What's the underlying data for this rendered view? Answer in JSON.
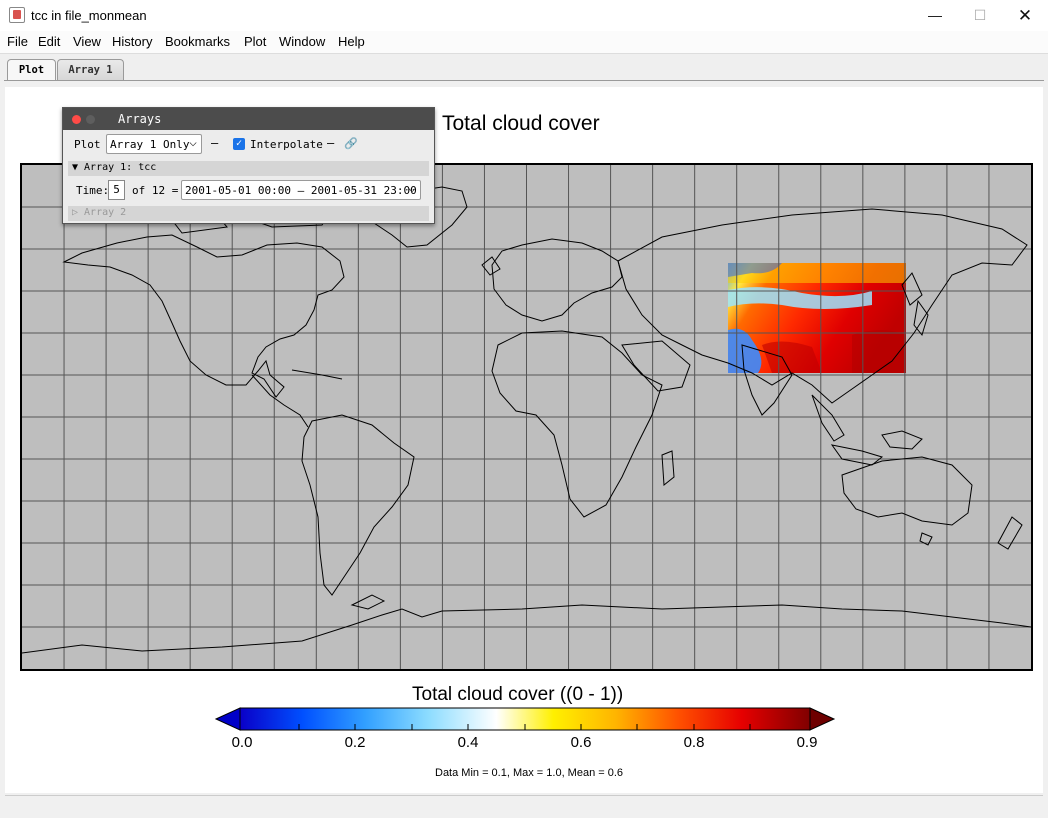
{
  "window": {
    "title": "tcc in file_monmean",
    "minimize": "—",
    "maximize": "☐",
    "close": "✕"
  },
  "menu": [
    "File",
    "Edit",
    "View",
    "History",
    "Bookmarks",
    "Plot",
    "Window",
    "Help"
  ],
  "tabs": [
    {
      "label": "Plot",
      "active": true
    },
    {
      "label": "Array 1",
      "active": false
    }
  ],
  "plot": {
    "title": "Total cloud cover",
    "projection": "equirectangular",
    "grid_spacing_deg": 15,
    "colorbar": {
      "title": "Total cloud cover ((0 - 1))",
      "ticks": [
        "0.0",
        "0.2",
        "0.4",
        "0.6",
        "0.8",
        "0.9"
      ],
      "colors": [
        "#0a00c8",
        "#0050ff",
        "#32a0ff",
        "#8cdcff",
        "#ffffff",
        "#fff000",
        "#ffb400",
        "#ff5000",
        "#e60000",
        "#800000"
      ],
      "under_color": "#0000c8",
      "over_color": "#6e0000"
    },
    "stats": "Data Min = 0.1, Max = 1.0, Mean = 0.6"
  },
  "arrays_panel": {
    "title": "Arrays",
    "plot_label": "Plot",
    "plot_mode": "Array 1 Only",
    "interpolate_label": "Interpolate",
    "interpolate_checked": true,
    "array1_header": "▼ Array 1: tcc",
    "time_label": "Time:",
    "time_index": "5",
    "time_of": "of 12 =",
    "time_range": "2001-05-01 00:00 — 2001-05-31 23:00",
    "array2_header": "▷ Array 2"
  }
}
